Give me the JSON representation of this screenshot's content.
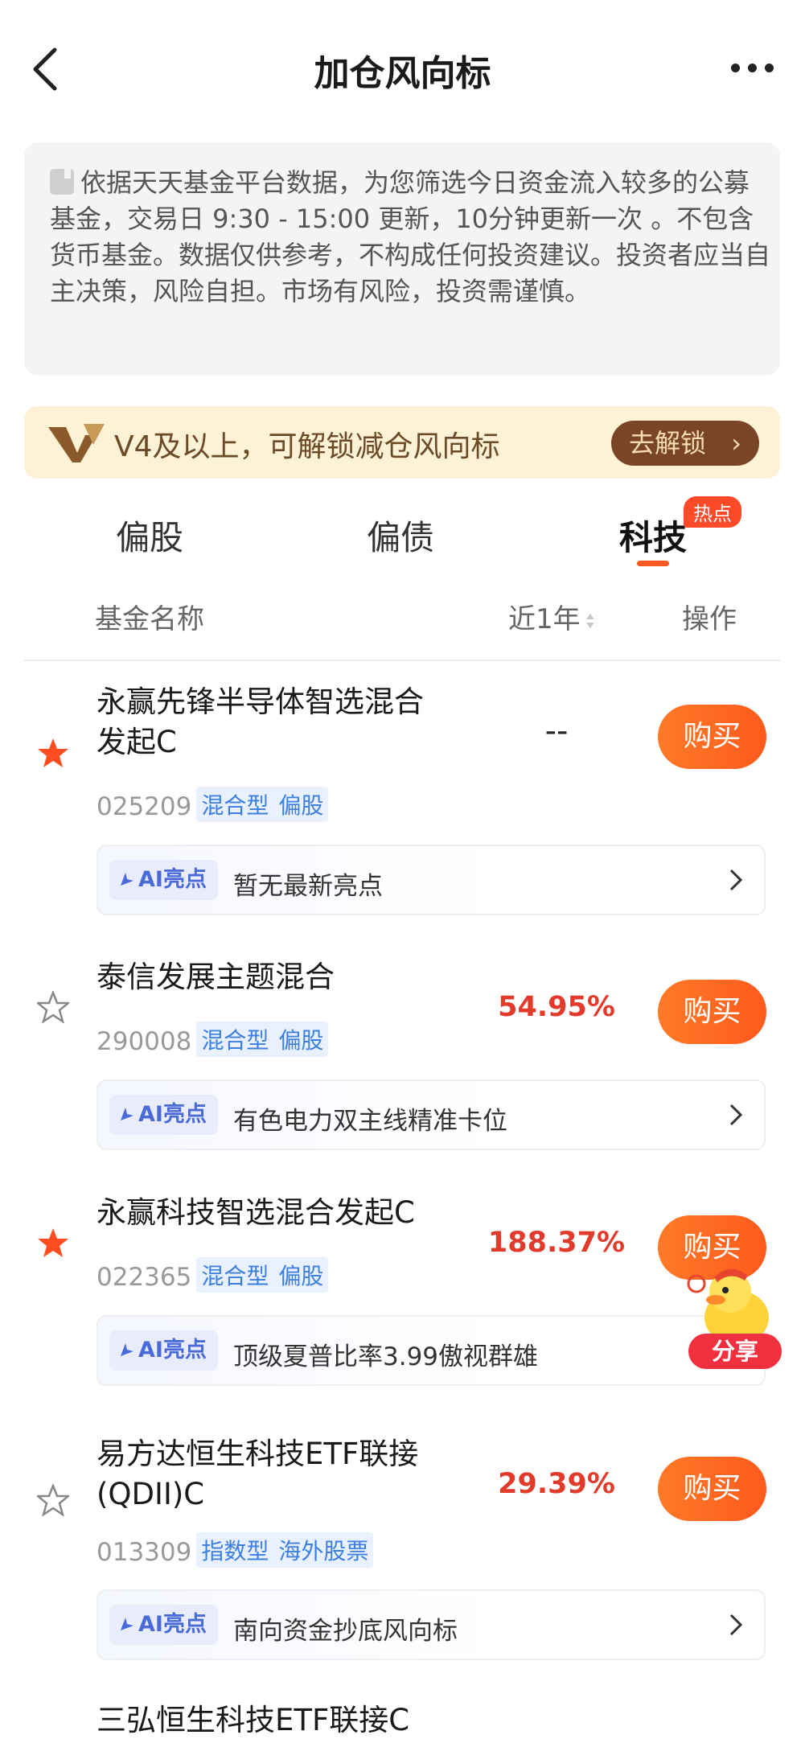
{
  "header": {
    "title": "加仓风向标"
  },
  "notice": {
    "text": "依据天天基金平台数据，为您筛选今日资金流入较多的公募基金，交易日 9:30 - 15:00 更新，10分钟更新一次 。不包含货币基金。数据仅供参考，不构成任何投资建议。投资者应当自主决策，风险自担。市场有风险，投资需谨慎。"
  },
  "banner": {
    "text": "V4及以上，可解锁减仓风向标",
    "button": "去解锁"
  },
  "tabs": [
    {
      "label": "偏股"
    },
    {
      "label": "偏债"
    },
    {
      "label": "科技",
      "badge": "热点",
      "active": true
    }
  ],
  "columns": {
    "name": "基金名称",
    "return": "近1年",
    "action": "操作"
  },
  "funds": [
    {
      "name_line1": "永赢先锋半导体智选混合",
      "name_line2": "发起C",
      "code": "025209",
      "type": "混合型",
      "style": "偏股",
      "return": "--",
      "starred": true,
      "buy": "购买",
      "ai_label": "AI亮点",
      "ai_text": "暂无最新亮点"
    },
    {
      "name_line1": "泰信发展主题混合",
      "code": "290008",
      "type": "混合型",
      "style": "偏股",
      "return": "54.95%",
      "starred": false,
      "buy": "购买",
      "ai_label": "AI亮点",
      "ai_text": "有色电力双主线精准卡位"
    },
    {
      "name_line1": "永赢科技智选混合发起C",
      "code": "022365",
      "type": "混合型",
      "style": "偏股",
      "return": "188.37%",
      "starred": true,
      "buy": "购买",
      "ai_label": "AI亮点",
      "ai_text": "顶级夏普比率3.99傲视群雄"
    },
    {
      "name_line1": "易方达恒生科技ETF联接",
      "name_line2": "(QDII)C",
      "code": "013309",
      "type": "指数型",
      "style": "海外股票",
      "return": "29.39%",
      "starred": false,
      "buy": "购买",
      "ai_label": "AI亮点",
      "ai_text": "南向资金抄底风向标"
    }
  ],
  "share": {
    "label": "分享"
  },
  "partial_row": {
    "name": "三弘恒生科技ETF联接C"
  },
  "colors": {
    "accent": "#ff5a1f",
    "return_red": "#e23b2c",
    "ai_blue": "#4a6ad8",
    "banner_bg": "#fdf2d6"
  }
}
